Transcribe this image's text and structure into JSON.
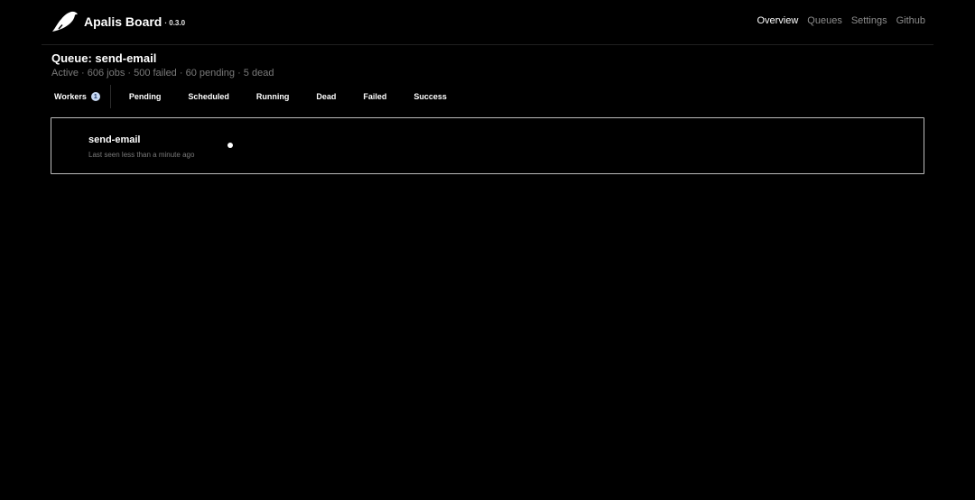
{
  "brand": {
    "title": "Apalis Board",
    "version": "· 0.3.0",
    "logo_icon": "bird-icon"
  },
  "nav": {
    "items": [
      {
        "label": "Overview",
        "active": true
      },
      {
        "label": "Queues",
        "active": false
      },
      {
        "label": "Settings",
        "active": false
      },
      {
        "label": "Github",
        "active": false
      }
    ]
  },
  "queue": {
    "title": "Queue: send-email",
    "subtitle": "Active · 606 jobs · 500 failed · 60 pending · 5 dead"
  },
  "tabs": {
    "workers": {
      "label": "Workers",
      "badge": "1"
    },
    "items": [
      {
        "label": "Pending"
      },
      {
        "label": "Scheduled"
      },
      {
        "label": "Running"
      },
      {
        "label": "Dead"
      },
      {
        "label": "Failed"
      },
      {
        "label": "Success"
      }
    ]
  },
  "worker": {
    "name": "send-email",
    "last_seen": "Last seen less than a minute ago",
    "status_icon": "status-dot-icon"
  },
  "colors": {
    "background": "#000000",
    "text": "#ffffff",
    "muted": "#7a7a7a",
    "badge_bg": "#c7d8f2",
    "card_border": "#bdbdbd"
  }
}
